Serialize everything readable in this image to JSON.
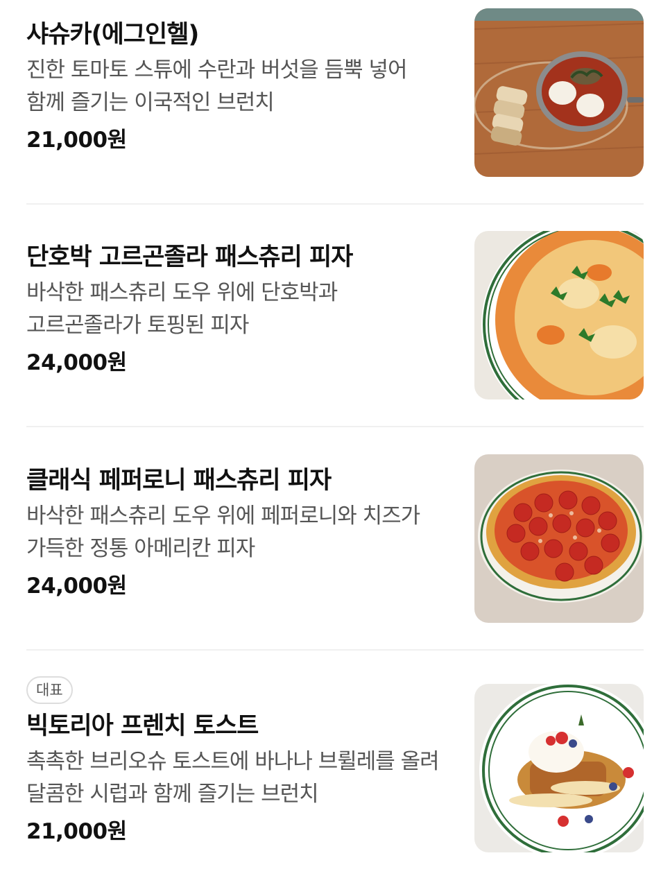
{
  "menu": {
    "items": [
      {
        "name": "샤슈카(에그인헬)",
        "description": "진한 토마토 스튜에 수란과 버섯을 듬뿍 넣어 함께 즐기는 이국적인 브런치",
        "price": "21,000원",
        "photo_icon": "shakshuka-photo"
      },
      {
        "name": "단호박 고르곤졸라 패스츄리 피자",
        "description": "바삭한 패스츄리 도우 위에 단호박과 고르곤졸라가 토핑된 피자",
        "price": "24,000원",
        "photo_icon": "pumpkin-pizza-photo"
      },
      {
        "name": "클래식 페퍼로니 패스츄리 피자",
        "description": "바삭한 패스츄리 도우 위에 페퍼로니와 치즈가 가득한 정통 아메리칸 피자",
        "price": "24,000원",
        "photo_icon": "pepperoni-pizza-photo"
      },
      {
        "badge": "대표",
        "name": "빅토리아 프렌치 토스트",
        "description": "촉촉한 브리오슈 토스트에 바나나 브륄레를 올려 달콤한 시럽과 함께 즐기는 브런치",
        "price": "21,000원",
        "photo_icon": "french-toast-photo"
      }
    ]
  }
}
